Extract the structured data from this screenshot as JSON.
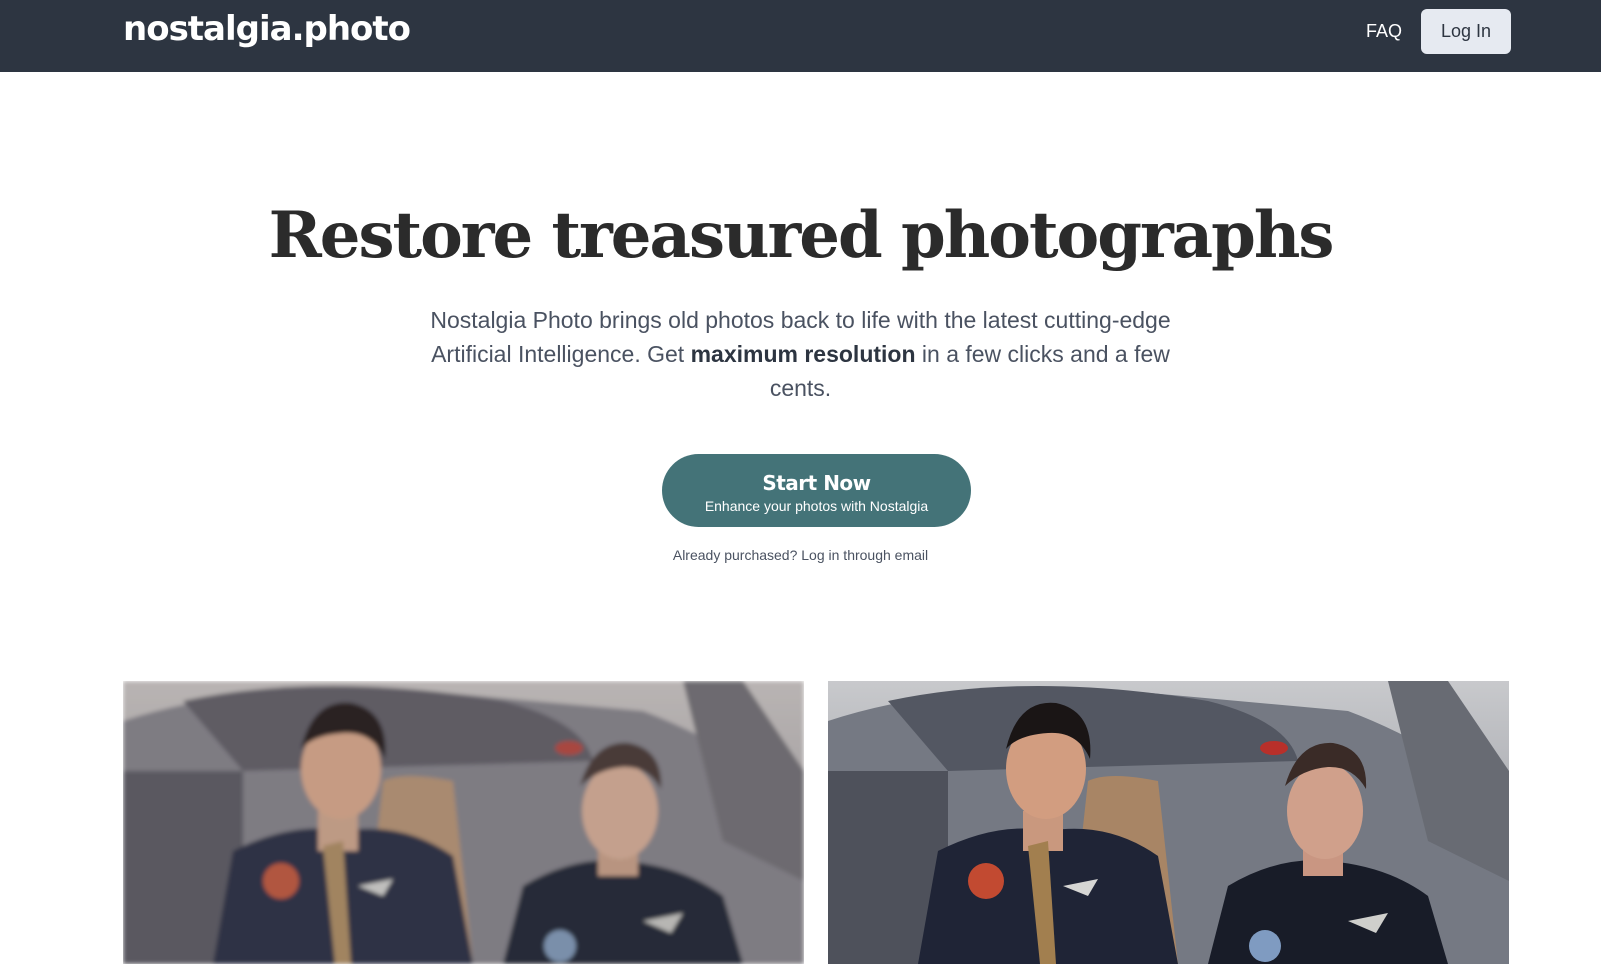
{
  "header": {
    "logo": "nostalgia.photo",
    "faq_label": "FAQ",
    "login_label": "Log In"
  },
  "hero": {
    "title": "Restore treasured photographs",
    "subtitle_part1": "Nostalgia Photo brings old photos back to life with the latest cutting-edge Artificial Intelligence. Get ",
    "subtitle_bold": "maximum resolution",
    "subtitle_part2": " in a few clicks and a few cents.",
    "cta_title": "Start Now",
    "cta_subtitle": "Enhance your photos with Nostalgia",
    "already_purchased": "Already purchased? Log in through email"
  },
  "colors": {
    "navbar_bg": "#2d3541",
    "cta_bg": "#447378",
    "login_bg": "#e6eaf1",
    "title_text": "#2b2b2b"
  }
}
